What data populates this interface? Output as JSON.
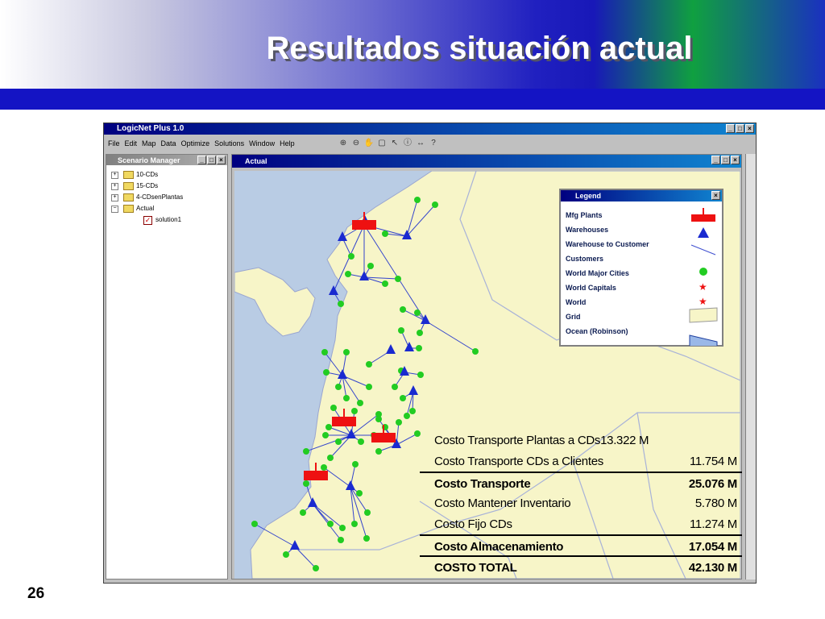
{
  "slide": {
    "title": "Resultados situación actual",
    "number": "26"
  },
  "app": {
    "title": "LogicNet Plus 1.0",
    "menu": [
      "File",
      "Edit",
      "Map",
      "Data",
      "Optimize",
      "Solutions",
      "Window",
      "Help"
    ],
    "scenario_panel": {
      "title": "Scenario Manager",
      "items": [
        "10-CDs",
        "15-CDs",
        "4-CDsenPlantas",
        "Actual",
        "solution1"
      ]
    },
    "map_window": {
      "title": "Actual"
    },
    "legend": {
      "title": "Legend",
      "items": [
        "Mfg Plants",
        "Warehouses",
        "Warehouse to Customer",
        "Customers",
        "World Major Cities",
        "World Capitals",
        "World",
        "Grid",
        "Ocean (Robinson)"
      ]
    }
  },
  "costs": {
    "rows": [
      {
        "label": "Costo Transporte Plantas a CDs",
        "value": "13.322 M"
      },
      {
        "label": "Costo Transporte CDs a Clientes",
        "value": "11.754 M"
      },
      {
        "label": "Costo Transporte",
        "value": "25.076 M"
      },
      {
        "label": "Costo Mantener Inventario",
        "value": "5.780 M"
      },
      {
        "label": "Costo Fijo CDs",
        "value": "11.274 M"
      },
      {
        "label": "Costo Almacenamiento",
        "value": "17.054 M"
      },
      {
        "label": "COSTO TOTAL",
        "value": "42.130 M"
      }
    ]
  },
  "colors": {
    "land": "#f7f5c8",
    "ocean": "#b9cce4",
    "plant": "#ee1111",
    "warehouse": "#1a2ad0",
    "customer": "#22cc22"
  }
}
